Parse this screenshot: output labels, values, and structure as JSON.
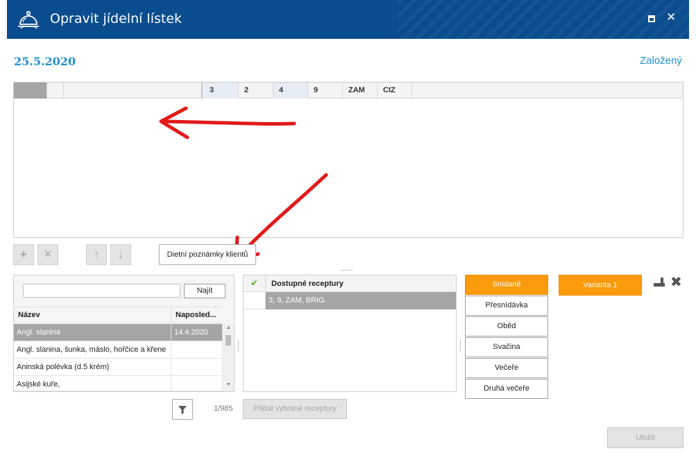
{
  "window": {
    "title": "Opravit jídelní lístek",
    "maximize_icon": "maximize-icon",
    "close_label": "✕"
  },
  "header": {
    "date": "25.5.2020",
    "status": "Založený"
  },
  "top_grid": {
    "columns": [
      "",
      "",
      "",
      "3",
      "2",
      "4",
      "9",
      "ZAM",
      "CIZ",
      ""
    ]
  },
  "toolbar": {
    "add_icon": "plus-icon",
    "remove_icon": "x-icon",
    "up_icon": "arrow-up-icon",
    "down_icon": "arrow-down-icon",
    "diet_notes_label": "Dietní poznámky klientů"
  },
  "recipe_search": {
    "query": "",
    "find_label": "Najít",
    "columns": [
      "Název",
      "Naposled..."
    ],
    "rows": [
      {
        "name": "Angl. slanina",
        "last": "14.4.2020",
        "selected": true
      },
      {
        "name": "Angl. slanina, šunka, máslo, hořčice a křene",
        "last": ""
      },
      {
        "name": "Aninská polévka (d.5 krém)",
        "last": ""
      },
      {
        "name": "Asijské kuře,",
        "last": ""
      }
    ]
  },
  "available_recipes": {
    "title": "Dostupné receptury",
    "rows": [
      {
        "text": "3, 9, ZAM, BRIG."
      }
    ],
    "add_label": "Přidat vybrané receptury"
  },
  "meals": [
    {
      "label": "Snídaně",
      "active": true
    },
    {
      "label": "Přesnídávka"
    },
    {
      "label": "Oběd"
    },
    {
      "label": "Svačina"
    },
    {
      "label": "Večeře"
    },
    {
      "label": "Druhá večeře"
    }
  ],
  "variant": {
    "label": "Varianta 1",
    "edit_icon": "edit-icon",
    "delete_icon": "delete-icon"
  },
  "footer": {
    "count": "1/985",
    "save_label": "Uložit",
    "filter_icon": "filter-icon"
  },
  "colors": {
    "titlebar": "#0a4d8f",
    "accent": "#1e90d0",
    "meal_active": "#fb9a0a",
    "selected_row": "#a5a5a5"
  }
}
